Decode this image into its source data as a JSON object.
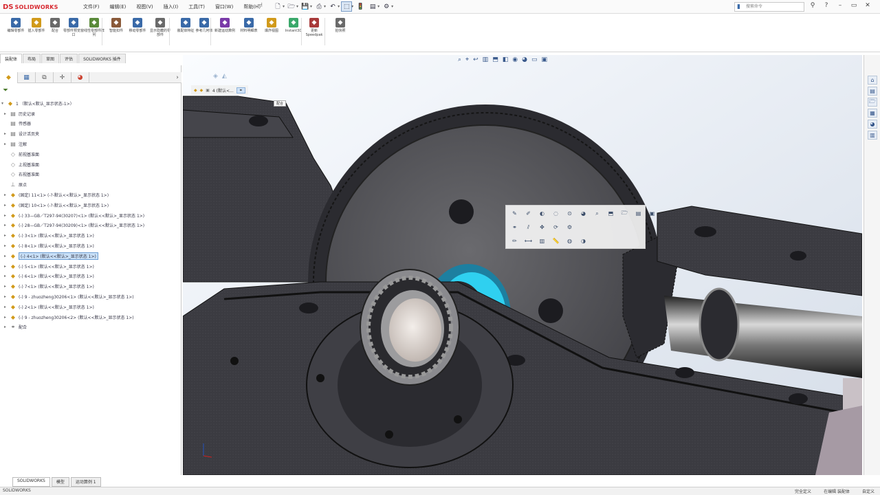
{
  "app": {
    "logo_mark": "DS",
    "logo_text": "SOLIDWORKS"
  },
  "menu": [
    "文件(F)",
    "编辑(E)",
    "视图(V)",
    "插入(I)",
    "工具(T)",
    "窗口(W)",
    "帮助(H)"
  ],
  "search": {
    "placeholder": "搜索命令"
  },
  "command_manager": [
    {
      "label": "编辑零部件",
      "color": "#3a6aa8"
    },
    {
      "label": "插入零部件",
      "color": "#d19a1b"
    },
    {
      "label": "配合",
      "color": "#6a6a6a"
    },
    {
      "label": "零部件预览窗口",
      "color": "#3a6aa8"
    },
    {
      "label": "线性零部件阵列",
      "color": "#5a8a3a"
    },
    {
      "label": "智能扣件",
      "color": "#8a5a3a"
    },
    {
      "label": "移动零部件",
      "color": "#3a6aa8"
    },
    {
      "label": "显示隐藏的零部件",
      "color": "#6a6a6a"
    },
    {
      "label": "装配体特征",
      "color": "#3a6aa8"
    },
    {
      "label": "参考几何体",
      "color": "#3a6aa8"
    },
    {
      "label": "新建运动算例",
      "color": "#7a3aa8"
    },
    {
      "label": "材料明细表",
      "color": "#3a6aa8"
    },
    {
      "label": "爆炸视图",
      "color": "#d19a1b"
    },
    {
      "label": "Instant3D",
      "color": "#3aa86a"
    },
    {
      "label": "更新 Speedpak",
      "color": "#a83a3a"
    },
    {
      "label": "拍快照",
      "color": "#6a6a6a"
    }
  ],
  "command_tabs": [
    {
      "label": "装配体",
      "active": true
    },
    {
      "label": "布局",
      "active": false
    },
    {
      "label": "草图",
      "active": false
    },
    {
      "label": "评估",
      "active": false
    },
    {
      "label": "SOLIDWORKS 插件",
      "active": false
    }
  ],
  "tree": [
    {
      "label": "1 （默认<默认_显示状态-1>）",
      "icon": "asm",
      "toggle": "▾",
      "level": 0
    },
    {
      "label": "历史记录",
      "icon": "folder",
      "toggle": "▸",
      "level": 1
    },
    {
      "label": "传感器",
      "icon": "folder",
      "toggle": "",
      "level": 1
    },
    {
      "label": "设计活页夹",
      "icon": "folder",
      "toggle": "▸",
      "level": 1
    },
    {
      "label": "注解",
      "icon": "folder",
      "toggle": "▸",
      "level": 1
    },
    {
      "label": "前视基准面",
      "icon": "plane",
      "toggle": "",
      "level": 1
    },
    {
      "label": "上视基准面",
      "icon": "plane",
      "toggle": "",
      "level": 1
    },
    {
      "label": "右视基准面",
      "icon": "plane",
      "toggle": "",
      "level": 1
    },
    {
      "label": "原点",
      "icon": "origin",
      "toggle": "",
      "level": 1
    },
    {
      "label": "(固定) 11<1> (-?-默认<<默认>_显示状态 1>)",
      "icon": "part",
      "toggle": "▸",
      "level": 1
    },
    {
      "label": "(固定) 10<1> (-?-默认<<默认>_显示状态 1>)",
      "icon": "part",
      "toggle": "▸",
      "level": 1
    },
    {
      "label": "(-) 33—GB／T297-94(30207)<1> (默认<<默认>_显示状态 1>)",
      "icon": "part",
      "toggle": "▸",
      "level": 1
    },
    {
      "label": "(-) 28—GB／T297-94(30209)<1> (默认<<默认>_显示状态 1>)",
      "icon": "part",
      "toggle": "▸",
      "level": 1
    },
    {
      "label": "(-) 3<1> (默认<<默认>_显示状态 1>)",
      "icon": "part",
      "toggle": "▸",
      "level": 1
    },
    {
      "label": "(-) 8<1> (默认<<默认>_显示状态 1>)",
      "icon": "part",
      "toggle": "▸",
      "level": 1
    },
    {
      "label": "(-) 4<1> (默认<<默认>_显示状态 1>)",
      "icon": "part",
      "toggle": "▸",
      "level": 1,
      "selected": true
    },
    {
      "label": "(-) 5<1> (默认<<默认>_显示状态 1>)",
      "icon": "part",
      "toggle": "▸",
      "level": 1
    },
    {
      "label": "(-) 6<1> (默认<<默认>_显示状态 1>)",
      "icon": "part",
      "toggle": "▸",
      "level": 1
    },
    {
      "label": "(-) 7<1> (默认<<默认>_显示状态 1>)",
      "icon": "part",
      "toggle": "▸",
      "level": 1
    },
    {
      "label": "(-) 9 - zhuozheng30206<1> (默认<<默认>_显示状态 1>)",
      "icon": "part",
      "toggle": "▸",
      "level": 1
    },
    {
      "label": "(-) 2<1> (默认<<默认>_显示状态 1>)",
      "icon": "part",
      "toggle": "▸",
      "level": 1
    },
    {
      "label": "(-) 9 - zhuozheng30206<2> (默认<<默认>_显示状态 1>)",
      "icon": "part",
      "toggle": "▸",
      "level": 1
    },
    {
      "label": "配合",
      "icon": "mate",
      "toggle": "▸",
      "level": 1
    }
  ],
  "breadcrumb": {
    "item": "4 (默认<...",
    "tooltip": "配合"
  },
  "bottom_tabs": [
    {
      "label": "SOLIDWORKS",
      "active": true
    },
    {
      "label": "模型",
      "active": false
    },
    {
      "label": "运动算例 1",
      "active": false
    }
  ],
  "status": {
    "left": "SOLIDWORKS",
    "right": [
      "完全定义",
      "在编辑 装配体",
      "自定义"
    ]
  },
  "colors": {
    "housing": "#3a3a40",
    "gear": "#555559",
    "highlight": "#2fd0f0"
  }
}
